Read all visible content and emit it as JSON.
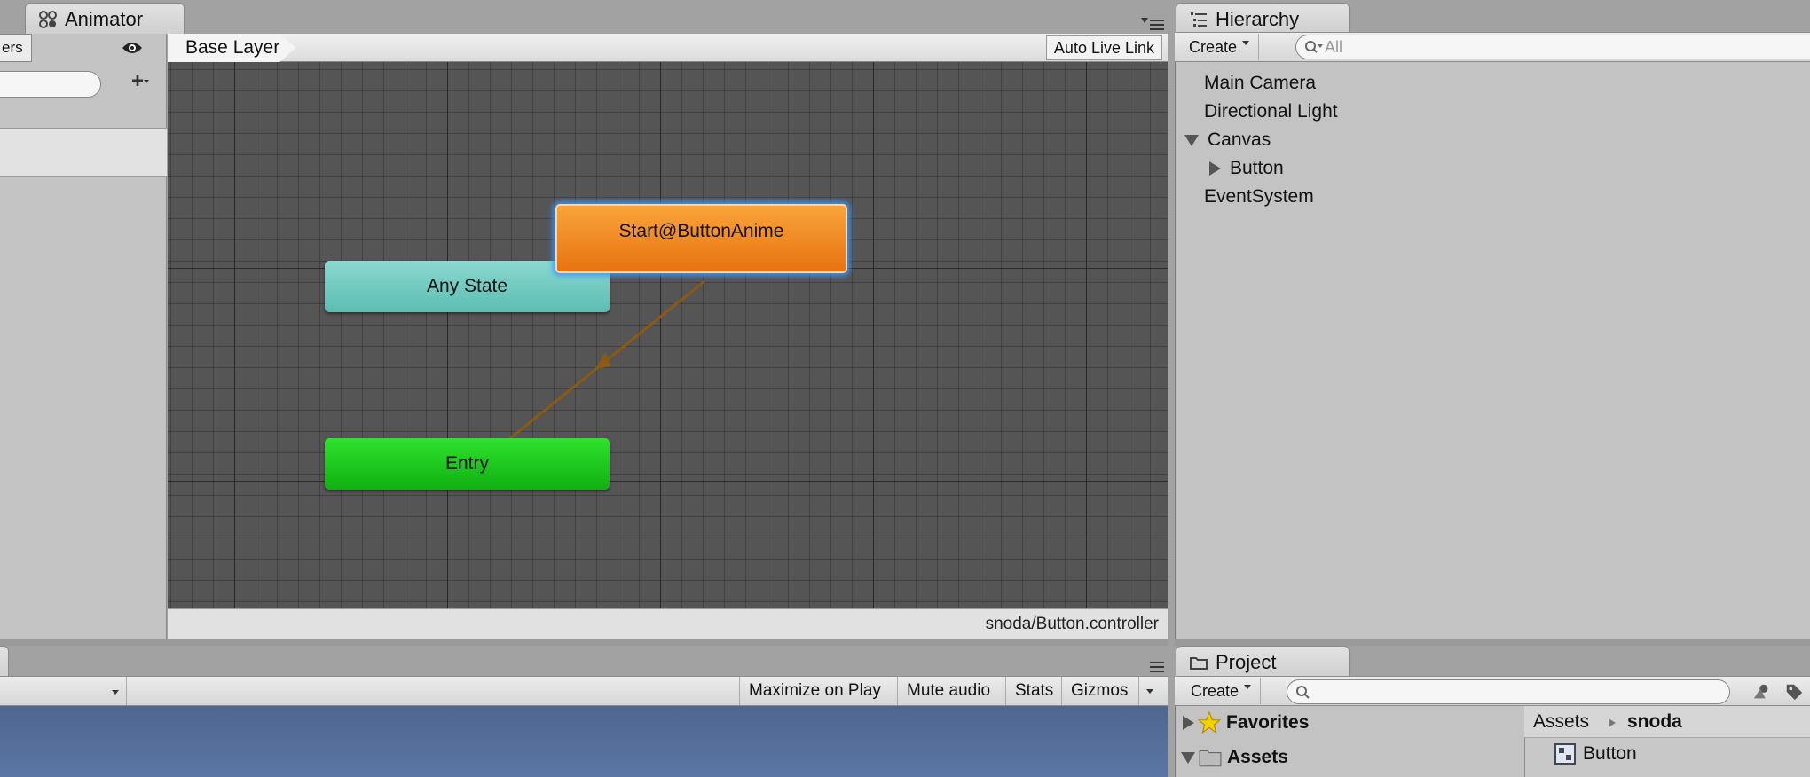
{
  "animator": {
    "tab_title": "Animator",
    "left_tab_label": "ers",
    "breadcrumb": "Base Layer",
    "auto_live_link": "Auto Live Link",
    "footer_path": "snoda/Button.controller",
    "states": {
      "any_state": "Any State",
      "entry": "Entry",
      "start": "Start@ButtonAnime"
    }
  },
  "hierarchy": {
    "tab_title": "Hierarchy",
    "create_label": "Create",
    "search_placeholder": "All",
    "items": [
      {
        "label": "Main Camera"
      },
      {
        "label": "Directional Light"
      },
      {
        "label": "Canvas"
      },
      {
        "label": "Button"
      },
      {
        "label": "EventSystem"
      }
    ]
  },
  "game": {
    "buttons": {
      "maximize": "Maximize on Play",
      "mute": "Mute audio",
      "stats": "Stats",
      "gizmos": "Gizmos"
    }
  },
  "project": {
    "tab_title": "Project",
    "create_label": "Create",
    "favorites": "Favorites",
    "assets_tree": "Assets",
    "breadcrumb_root": "Assets",
    "breadcrumb_current": "snoda",
    "items": [
      {
        "label": "Button"
      }
    ]
  },
  "colors": {
    "graph_bg": "#555555",
    "any_state": "#6fcabf",
    "entry": "#1ec81e",
    "start": "#ef8a1f",
    "transition": "#8a5a12"
  }
}
